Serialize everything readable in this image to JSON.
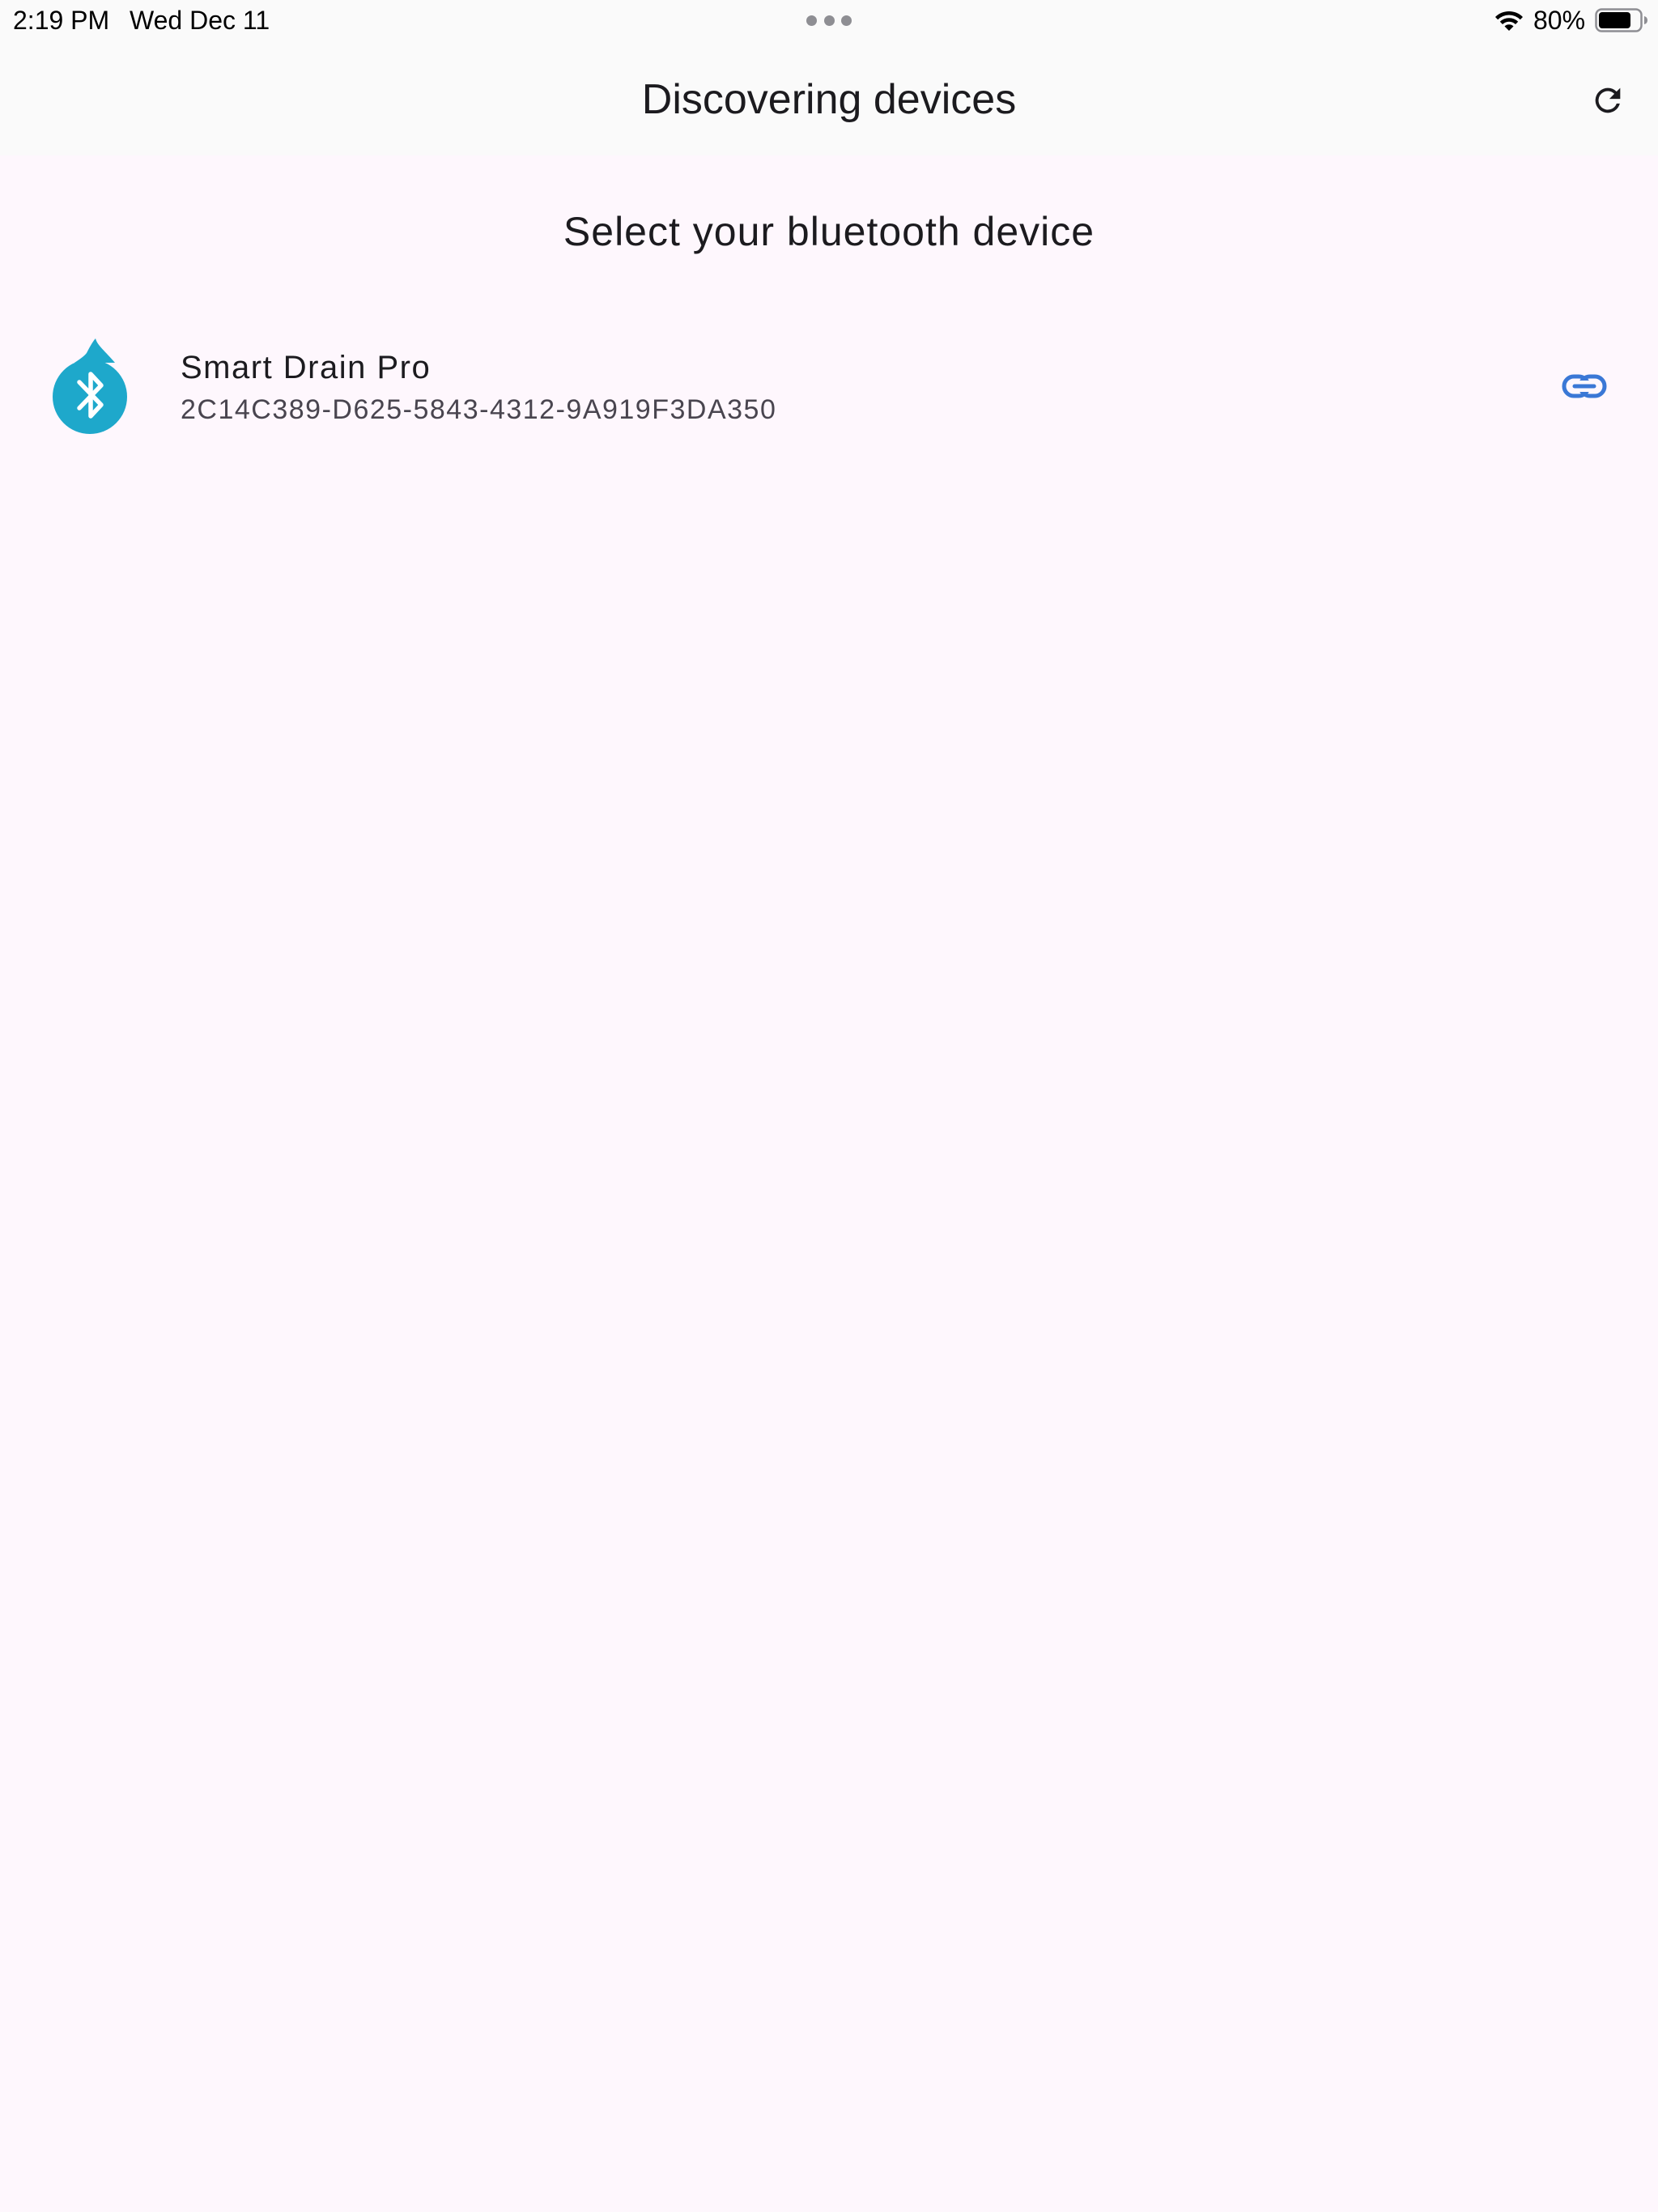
{
  "status_bar": {
    "time": "2:19 PM",
    "date": "Wed Dec 11",
    "battery_percent": "80%",
    "battery_level": 0.8,
    "icons": [
      "multitask-dots",
      "wifi-icon",
      "battery-icon"
    ]
  },
  "app_bar": {
    "title": "Discovering devices",
    "refresh_icon": "refresh-icon"
  },
  "content": {
    "heading": "Select your bluetooth device",
    "devices": [
      {
        "name": "Smart Drain Pro",
        "id": "2C14C389-D625-5843-4312-9A919F3DA350",
        "logo_icon": "bluetooth-drop-icon",
        "action_icon": "link-icon"
      }
    ]
  },
  "colors": {
    "background": "#fef7fd",
    "app_bar": "#fafafa",
    "brand_teal": "#1ea8cb",
    "link_blue": "#3a78d6"
  }
}
